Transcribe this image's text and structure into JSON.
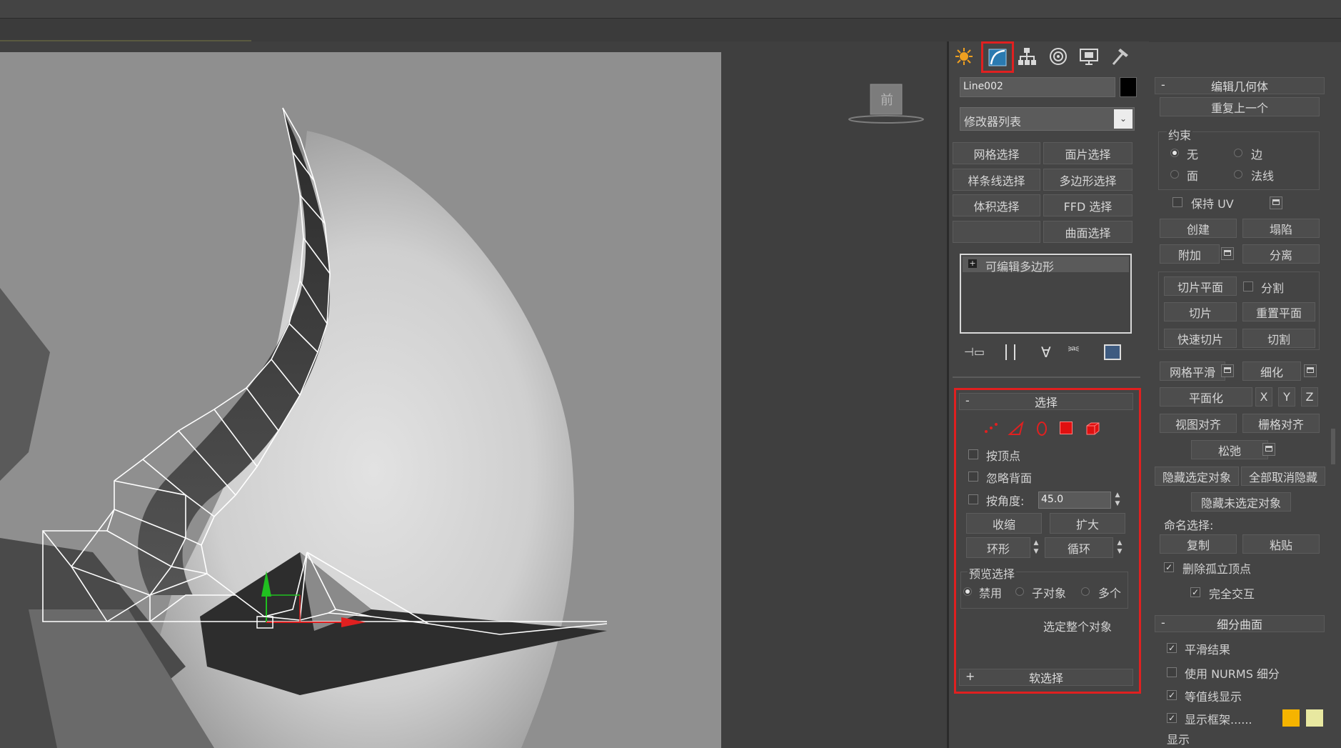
{
  "object_name": "Line002",
  "object_color": "#000000",
  "modifier_list": {
    "placeholder": "修改器列表"
  },
  "quick_buttons": [
    "网格选择",
    "面片选择",
    "样条线选择",
    "多边形选择",
    "体积选择",
    "FFD 选择",
    "",
    "曲面选择"
  ],
  "stack": {
    "item": "可编辑多边形"
  },
  "selection_rollout": {
    "title": "选择",
    "sign": "-",
    "by_vertex": "按顶点",
    "ignore_backfacing": "忽略背面",
    "by_angle": "按角度:",
    "angle_value": "45.0",
    "shrink": "收缩",
    "grow": "扩大",
    "ring": "环形",
    "loop": "循环",
    "preview_selection": "预览选择",
    "preview_options": [
      "禁用",
      "子对象",
      "多个"
    ],
    "select_whole": "选定整个对象"
  },
  "soft_selection": {
    "title": "软选择",
    "sign": "+"
  },
  "edit_geometry": {
    "title": "编辑几何体",
    "sign": "-",
    "repeat_last": "重复上一个",
    "constraints_label": "约束",
    "constraints": [
      "无",
      "边",
      "面",
      "法线"
    ],
    "preserve_uv": "保持 UV",
    "create": "创建",
    "collapse": "塌陷",
    "attach": "附加",
    "detach": "分离",
    "slice_plane": "切片平面",
    "split": "分割",
    "slice": "切片",
    "reset_plane": "重置平面",
    "quickslice": "快速切片",
    "cut": "切割",
    "meshsmooth": "网格平滑",
    "tessellate": "细化",
    "make_planar": "平面化",
    "axes": [
      "X",
      "Y",
      "Z"
    ],
    "view_align": "视图对齐",
    "grid_align": "栅格对齐",
    "relax": "松弛",
    "hide_selected": "隐藏选定对象",
    "unhide_all": "全部取消隐藏",
    "hide_unselected": "隐藏未选定对象",
    "named_selections": "命名选择:",
    "copy": "复制",
    "paste": "粘贴",
    "delete_isolated": "删除孤立顶点",
    "full_interactivity": "完全交互"
  },
  "subdivision_surface": {
    "title": "细分曲面",
    "sign": "-",
    "smooth_result": "平滑结果",
    "use_nurms": "使用 NURMS 细分",
    "isoline_display": "等值线显示",
    "show_cage": "显示框架......",
    "display_label": "显示",
    "cage_colors": [
      "#f5b400",
      "#e8e8a0"
    ]
  },
  "viewcube_label": "前",
  "highlight_color": "#e02020"
}
